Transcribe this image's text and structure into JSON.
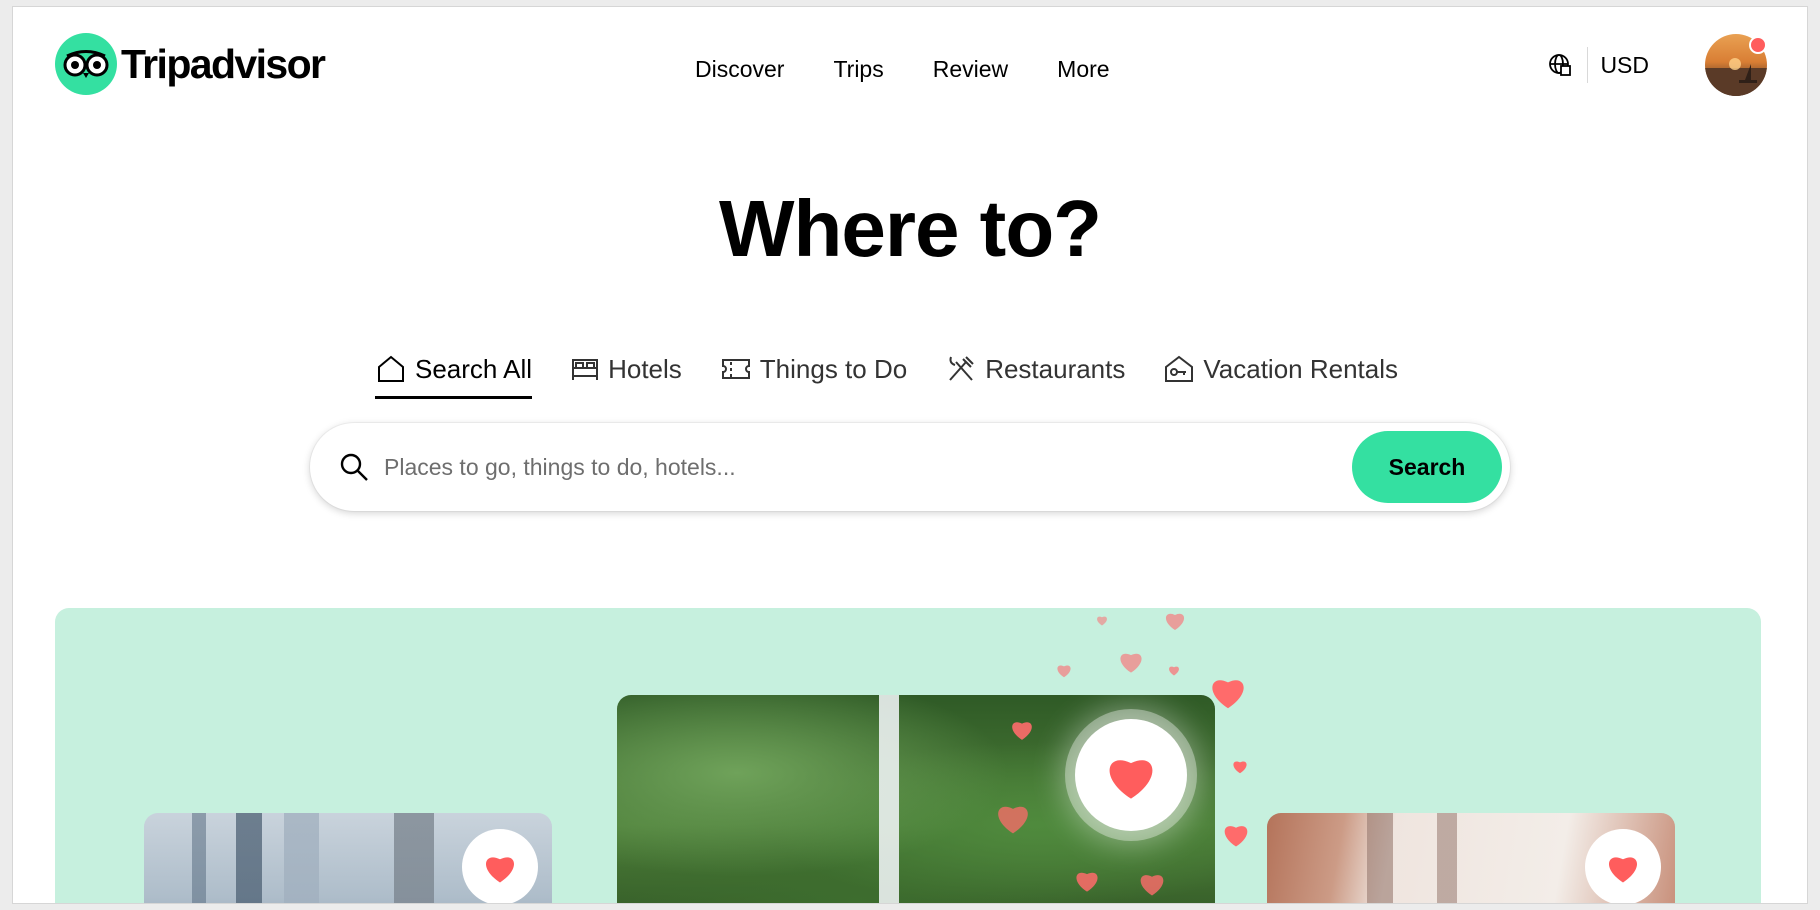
{
  "header": {
    "brand": "Tripadvisor",
    "nav": [
      "Discover",
      "Trips",
      "Review",
      "More"
    ],
    "currency": "USD",
    "notification_color": "#ff5d5d"
  },
  "hero": {
    "title": "Where to?",
    "tabs": [
      {
        "label": "Search All",
        "icon": "home-icon",
        "active": true
      },
      {
        "label": "Hotels",
        "icon": "bed-icon",
        "active": false
      },
      {
        "label": "Things to Do",
        "icon": "ticket-icon",
        "active": false
      },
      {
        "label": "Restaurants",
        "icon": "utensils-icon",
        "active": false
      },
      {
        "label": "Vacation Rentals",
        "icon": "house-key-icon",
        "active": false
      }
    ],
    "search": {
      "placeholder": "Places to go, things to do, hotels...",
      "button_label": "Search"
    }
  },
  "promo": {
    "cards": [
      {
        "name": "city-skyline-card",
        "favorited_icon": "heart-icon"
      },
      {
        "name": "waterfall-card",
        "favorited_icon": "heart-icon"
      },
      {
        "name": "architecture-card",
        "favorited_icon": "heart-icon"
      }
    ]
  },
  "colors": {
    "brand_green": "#34e0a1",
    "promo_bg": "#c6f0de",
    "heart": "#ff5d5d"
  }
}
